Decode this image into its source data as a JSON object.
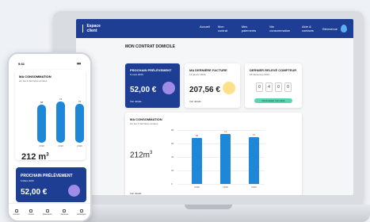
{
  "desktop": {
    "brand": "Espace client",
    "nav": [
      "Accueil",
      "Mon contrat",
      "Mes paiements",
      "Ma consommation",
      "Aide & contacts"
    ],
    "user": "Bienvenue",
    "page_title": "MON CONTRAT DOMICILE",
    "cards": {
      "prochain": {
        "title": "PROCHAIN PRÉLÈVEMENT",
        "sub": "6 mars 2020",
        "amount": "52,00 €",
        "link": "Voir détails"
      },
      "facture": {
        "title": "MA DERNIÈRE FACTURE",
        "sub": "12 janvier 2020",
        "amount": "207,56 €",
        "link": "Voir détails"
      },
      "releve": {
        "title": "DERNIER RELEVÉ COMPTEUR",
        "sub": "18 décembre 2019",
        "digits": [
          "0",
          "4",
          "0",
          "0"
        ],
        "button": "Communiquer mon relevé"
      }
    },
    "consumption": {
      "title": "MA CONSOMMATION",
      "sub": "sur les 3 dernières années",
      "value": "212m",
      "unit_sup": "3",
      "link": "Voir détails"
    }
  },
  "phone": {
    "time": "9:41",
    "consumption": {
      "title": "MA CONSOMMATION",
      "sub": "sur les 3 dernières années",
      "value": "212 m",
      "unit_sup": "3"
    },
    "plan": {
      "title": "PROCHAIN PRÉLÈVEMENT",
      "sub": "6 Mars 2020",
      "amount": "52,00 €"
    },
    "tabs": [
      "Accueil",
      "Conso",
      "Paiements",
      "Factures",
      "Échanges"
    ]
  },
  "chart_data": {
    "type": "bar",
    "categories": [
      "2018",
      "2019",
      "2020"
    ],
    "values": [
      68,
      74,
      70
    ],
    "yticks": [
      "80",
      "60",
      "40",
      "20",
      "0"
    ],
    "ylim": [
      0,
      80
    ],
    "data_labels": [
      "68",
      "74",
      "70"
    ],
    "bar_color": "#1f87d8",
    "label_color": "#e33333"
  }
}
